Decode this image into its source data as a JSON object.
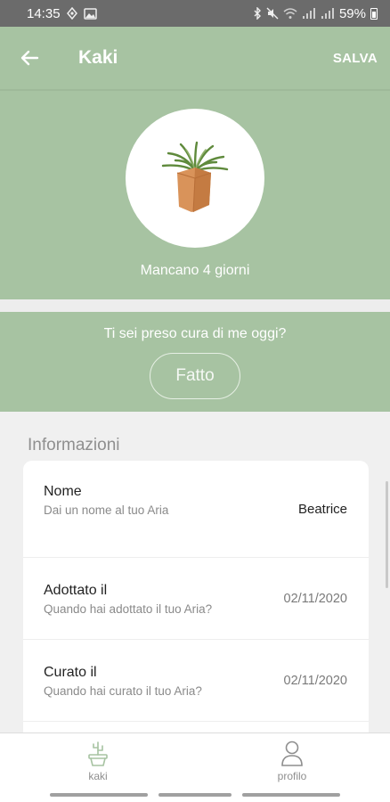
{
  "status_bar": {
    "time": "14:35",
    "battery": "59%"
  },
  "header": {
    "title": "Kaki",
    "save_label": "SALVA"
  },
  "hero": {
    "days_left_text": "Mancano 4 giorni"
  },
  "care": {
    "question": "Ti sei preso cura di me oggi?",
    "done_label": "Fatto"
  },
  "info": {
    "section_title": "Informazioni",
    "rows": [
      {
        "label": "Nome",
        "hint": "Dai un nome al tuo Aria",
        "value": "Beatrice"
      },
      {
        "label": "Adottato il",
        "hint": "Quando hai adottato il tuo Aria?",
        "value": "02/11/2020"
      },
      {
        "label": "Curato il",
        "hint": "Quando hai curato il tuo Aria?",
        "value": "02/11/2020"
      }
    ]
  },
  "bottom_nav": {
    "items": [
      {
        "label": "kaki",
        "icon": "cactus-pot-icon"
      },
      {
        "label": "profilo",
        "icon": "user-icon"
      }
    ]
  },
  "colors": {
    "accent_green": "#a7c3a2",
    "status_bar": "#6b6b6b",
    "background": "#f0f0f0"
  }
}
